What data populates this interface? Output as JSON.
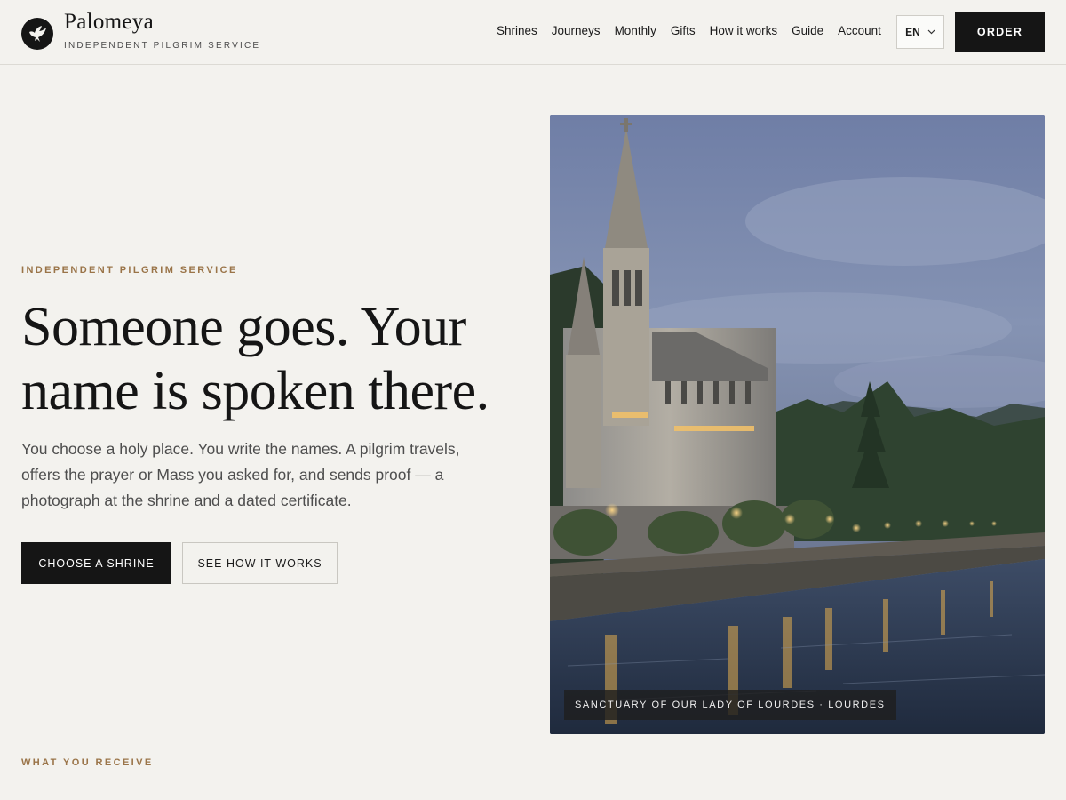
{
  "header": {
    "brand_name": "Palomeya",
    "brand_tagline": "INDEPENDENT PILGRIM SERVICE",
    "logo_icon": "dove-icon",
    "nav": [
      {
        "label": "Shrines"
      },
      {
        "label": "Journeys"
      },
      {
        "label": "Monthly"
      },
      {
        "label": "Gifts"
      },
      {
        "label": "How it works"
      },
      {
        "label": "Guide"
      },
      {
        "label": "Account"
      }
    ],
    "language": "EN",
    "order_label": "ORDER"
  },
  "hero": {
    "eyebrow": "INDEPENDENT PILGRIM SERVICE",
    "title": "Someone goes. Your name is spoken there.",
    "body": "You choose a holy place. You write the names. A pilgrim travels, offers the prayer or Mass you asked for, and sends proof — a photograph at the shrine and a dated certificate.",
    "primary_cta": "CHOOSE A SHRINE",
    "secondary_cta": "SEE HOW IT WORKS",
    "image_caption": "SANCTUARY OF OUR LADY OF LOURDES · LOURDES"
  },
  "next_section": {
    "eyebrow": "WHAT YOU RECEIVE"
  },
  "colors": {
    "background": "#f3f2ee",
    "ink": "#151515",
    "accent": "#9a7448",
    "muted_text": "#4e4e4e"
  }
}
